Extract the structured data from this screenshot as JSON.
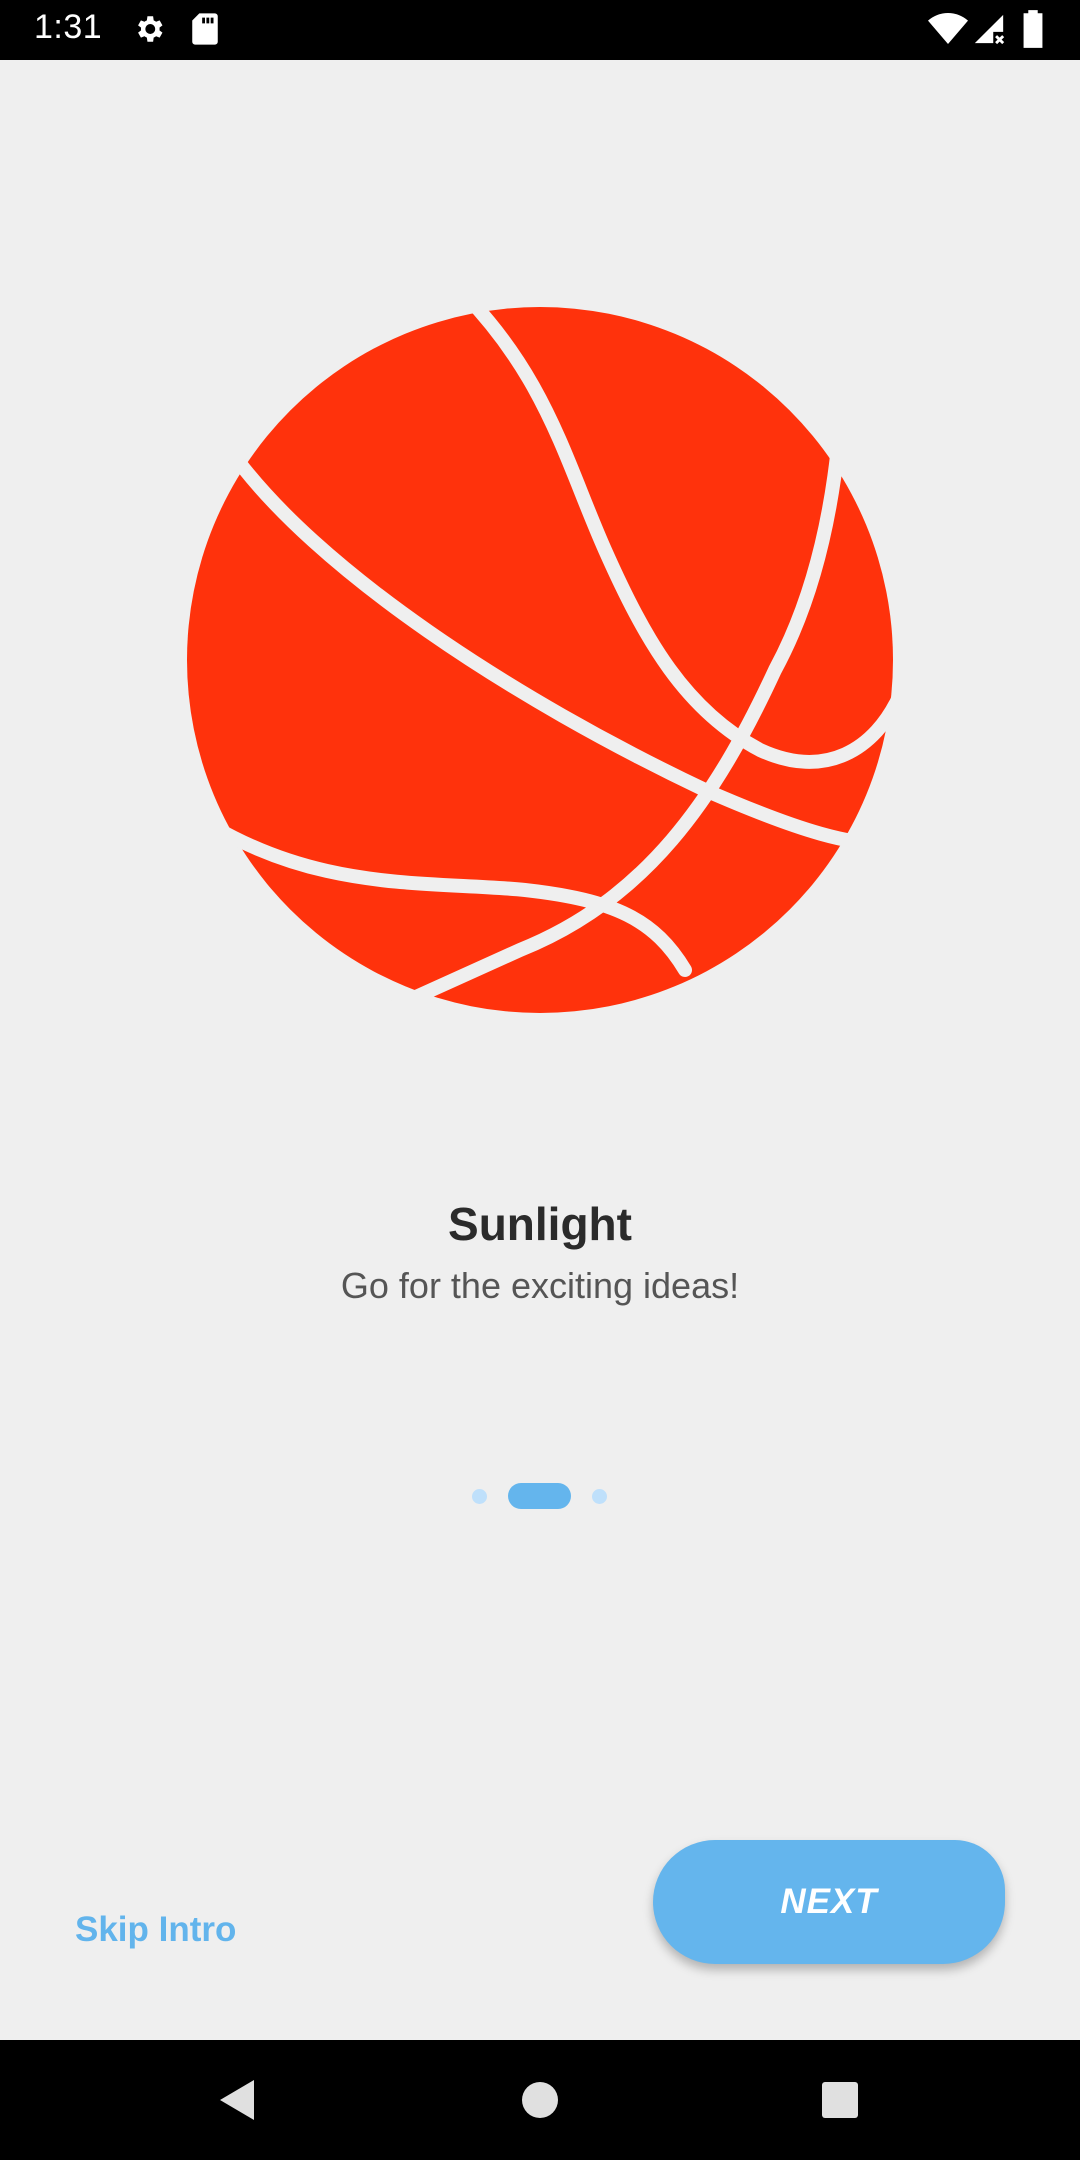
{
  "status_bar": {
    "time": "1:31",
    "left_icons": [
      "settings-icon",
      "sd-card-icon"
    ],
    "right_icons": [
      "wifi-icon",
      "cell-signal-icon",
      "battery-icon"
    ]
  },
  "intro": {
    "illustration": "basketball-icon",
    "title": "Sunlight",
    "subtitle": "Go for the exciting ideas!",
    "page_indicator": {
      "count": 3,
      "active_index": 1
    }
  },
  "footer": {
    "skip_label": "Skip Intro",
    "next_label": "NEXT"
  },
  "nav_bar": {
    "buttons": [
      "back-icon",
      "home-icon",
      "recents-icon"
    ]
  },
  "colors": {
    "accent": "#64b5ed",
    "ball": "#ff320c",
    "background": "#efefef"
  }
}
